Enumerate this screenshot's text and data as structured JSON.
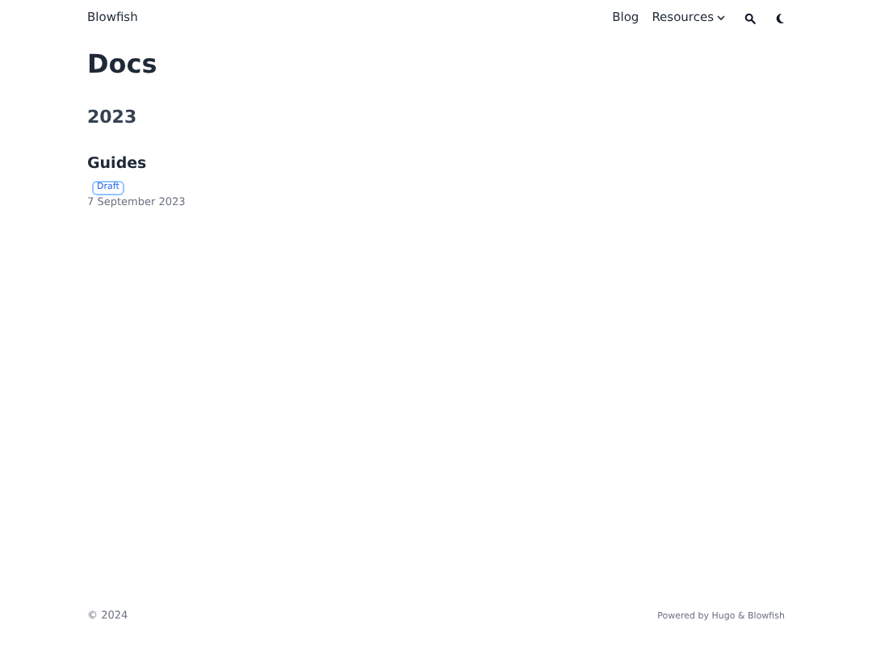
{
  "header": {
    "site_title": "Blowfish",
    "menu": [
      {
        "label": "Blog",
        "kind": "link"
      },
      {
        "label": "Resources",
        "kind": "dropdown"
      }
    ],
    "icons": [
      {
        "kind": "search"
      },
      {
        "kind": "theme"
      }
    ]
  },
  "page": {
    "title": "Docs",
    "groups": [
      {
        "year": "2023",
        "articles": [
          {
            "title": "Guides",
            "badge": "Draft",
            "date": "7 September 2023"
          }
        ]
      }
    ]
  },
  "footer": {
    "copyright": "© 2024",
    "powered_by": "Powered by Hugo & Blowfish"
  }
}
